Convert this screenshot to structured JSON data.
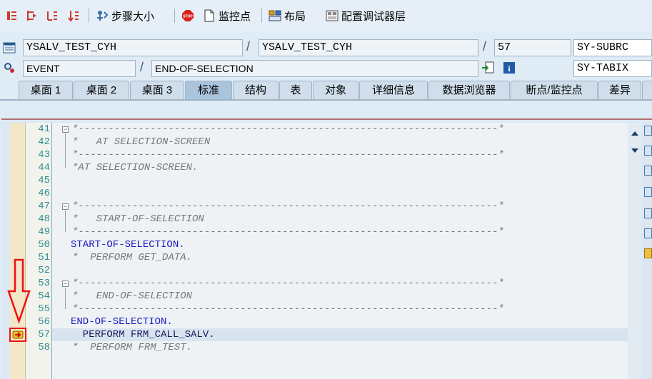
{
  "toolbar": {
    "step_size_label": "步骤大小",
    "watchpoint_label": "监控点",
    "layout_label": "布局",
    "config_layers_label": "配置调试器层"
  },
  "info": {
    "program1": "YSALV_TEST_CYH",
    "program2": "YSALV_TEST_CYH",
    "line_no": "57",
    "var1": "SY-SUBRC",
    "event_type": "EVENT",
    "event_name": "END-OF-SELECTION",
    "var2": "SY-TABIX",
    "separator": "/"
  },
  "tabs": [
    {
      "label": "桌面 1",
      "active": false
    },
    {
      "label": "桌面 2",
      "active": false
    },
    {
      "label": "桌面 3",
      "active": false
    },
    {
      "label": "标准",
      "active": true
    },
    {
      "label": "结构",
      "active": false
    },
    {
      "label": "表",
      "active": false
    },
    {
      "label": "对象",
      "active": false
    },
    {
      "label": "详细信息",
      "active": false
    },
    {
      "label": "数据浏览器",
      "active": false
    },
    {
      "label": "断点/监控点",
      "active": false
    },
    {
      "label": "差异",
      "active": false
    }
  ],
  "code_lines": [
    {
      "no": "41",
      "text": "*----------------------------------------------------------------------*"
    },
    {
      "no": "42",
      "text": "*   AT SELECTION-SCREEN"
    },
    {
      "no": "43",
      "text": "*----------------------------------------------------------------------*"
    },
    {
      "no": "44",
      "text": "*AT SELECTION-SCREEN."
    },
    {
      "no": "45",
      "text": ""
    },
    {
      "no": "46",
      "text": ""
    },
    {
      "no": "47",
      "text": "*----------------------------------------------------------------------*"
    },
    {
      "no": "48",
      "text": "*   START-OF-SELECTION"
    },
    {
      "no": "49",
      "text": "*----------------------------------------------------------------------*"
    },
    {
      "no": "50",
      "text": "START-OF-SELECTION."
    },
    {
      "no": "51",
      "text": "*  PERFORM GET_DATA."
    },
    {
      "no": "52",
      "text": ""
    },
    {
      "no": "53",
      "text": "*----------------------------------------------------------------------*"
    },
    {
      "no": "54",
      "text": "*   END-OF-SELECTION"
    },
    {
      "no": "55",
      "text": "*----------------------------------------------------------------------*"
    },
    {
      "no": "56",
      "text": "END-OF-SELECTION."
    },
    {
      "no": "57",
      "text": "  PERFORM FRM_CALL_SALV."
    },
    {
      "no": "58",
      "text": "*  PERFORM FRM_TEST."
    }
  ],
  "colors": {
    "annotation": "#ee1111",
    "keyword": "#1b1bc4",
    "comment": "#777777",
    "line_number": "#2f8f8f"
  }
}
